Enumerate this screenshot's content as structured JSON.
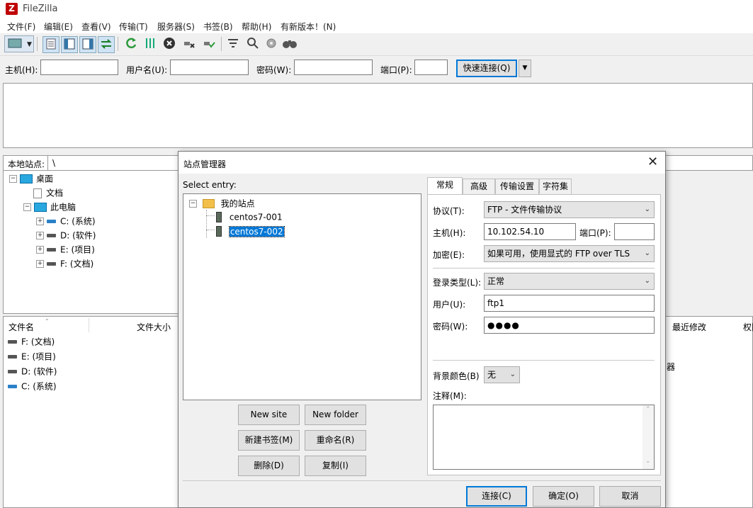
{
  "app": {
    "title": "FileZilla",
    "logo_text": "Z"
  },
  "menu": [
    "文件(F)",
    "编辑(E)",
    "查看(V)",
    "传输(T)",
    "服务器(S)",
    "书签(B)",
    "帮助(H)",
    "有新版本！(N)"
  ],
  "quickconnect": {
    "host_label": "主机(H):",
    "user_label": "用户名(U):",
    "pass_label": "密码(W):",
    "port_label": "端口(P):",
    "button_label": "快速连接(Q)"
  },
  "local": {
    "site_label": "本地站点:",
    "path": "\\",
    "tree": [
      {
        "label": "桌面",
        "level": 0,
        "expander": "−",
        "icon": "desktop-icon"
      },
      {
        "label": "文档",
        "level": 1,
        "expander": "",
        "icon": "document-icon"
      },
      {
        "label": "此电脑",
        "level": 1,
        "expander": "−",
        "icon": "computer-icon"
      },
      {
        "label": "C: (系统)",
        "level": 2,
        "expander": "+",
        "icon": "drive-icon"
      },
      {
        "label": "D: (软件)",
        "level": 2,
        "expander": "+",
        "icon": "drive-icon"
      },
      {
        "label": "E: (项目)",
        "level": 2,
        "expander": "+",
        "icon": "drive-icon"
      },
      {
        "label": "F: (文档)",
        "level": 2,
        "expander": "+",
        "icon": "drive-icon"
      }
    ],
    "columns": {
      "name": "文件名",
      "size": "文件大小"
    },
    "files": [
      "F: (文档)",
      "E: (项目)",
      "D: (软件)",
      "C: (系统)"
    ]
  },
  "remote": {
    "col_modified": "最近修改",
    "col_perm": "权限",
    "partial_text": "器"
  },
  "site_manager": {
    "title": "站点管理器",
    "select_entry_label": "Select entry:",
    "root_folder": "我的站点",
    "sites": [
      "centos7-001",
      "centos7-002"
    ],
    "selected_site": "centos7-002",
    "buttons": {
      "new_site": "New site",
      "new_folder": "New folder",
      "new_bookmark": "新建书签(M)",
      "rename": "重命名(R)",
      "delete": "删除(D)",
      "duplicate": "复制(I)",
      "connect": "连接(C)",
      "ok": "确定(O)",
      "cancel": "取消"
    },
    "tabs": [
      "常规",
      "高级",
      "传输设置",
      "字符集"
    ],
    "active_tab": "常规",
    "general": {
      "protocol_label": "协议(T):",
      "protocol_value": "FTP - 文件传输协议",
      "host_label": "主机(H):",
      "host_value": "10.102.54.10",
      "port_label": "端口(P):",
      "port_value": "",
      "encryption_label": "加密(E):",
      "encryption_value": "如果可用，使用显式的 FTP over TLS",
      "logon_type_label": "登录类型(L):",
      "logon_type_value": "正常",
      "user_label": "用户(U):",
      "user_value": "ftp1",
      "password_label": "密码(W):",
      "password_value": "●●●●",
      "bg_color_label": "背景颜色(B)",
      "bg_color_value": "无",
      "comments_label": "注释(M):"
    }
  }
}
